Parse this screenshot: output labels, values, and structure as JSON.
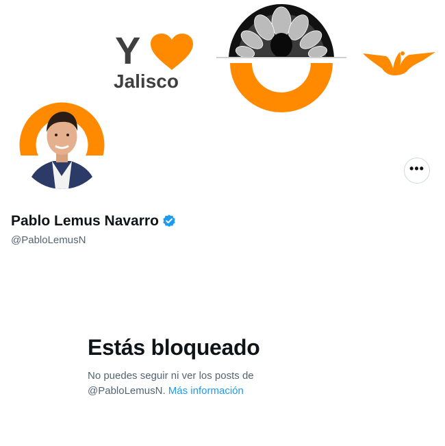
{
  "banner": {
    "logo_letter": "Y",
    "logo_word": "Jalisco",
    "logo_color": "#3f3f3f",
    "accent_color": "#ff8a00"
  },
  "profile": {
    "name": "Pablo Lemus Navarro",
    "handle": "@PabloLemusN",
    "verified_color": "#1d9bf0",
    "more_label": "•••"
  },
  "blocked": {
    "title": "Estás bloqueado",
    "message": "No puedes seguir ni ver los posts de",
    "handle": "@PabloLemusN.",
    "link_label": "Más información",
    "link_color": "#1d9bf0"
  }
}
